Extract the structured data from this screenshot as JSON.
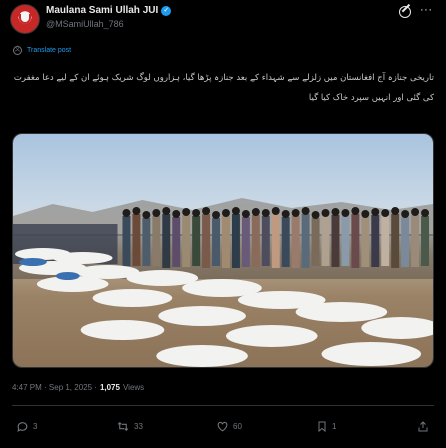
{
  "author": {
    "name": "Maulana Sami Ullah JUI",
    "handle": "@MSamiUllah_786"
  },
  "translate_label": "Translate post",
  "post_text": "تاریخی جنازہ آج افغانستان میں زلزلے سے شہداء کے بعد جنازہ پڑھا گیا، ہزاروں لوگ شریک ہوئے ان کے لیے دعا مغفرت کی گئی اور انہیں سپرد خاک کیا گیا",
  "timestamp": "4:47 PM · Sep 1, 2025 · ",
  "views_count": "1,075",
  "views_label": "Views",
  "actions": {
    "replies": "3",
    "reposts": "33",
    "likes": "60",
    "bookmarks": "1"
  },
  "icons": [
    "grok-icon",
    "more-icon",
    "translate-icon",
    "reply-icon",
    "repost-icon",
    "like-icon",
    "bookmark-icon",
    "share-icon"
  ],
  "colors": {
    "accent": "#1d9bf0",
    "background": "#000000",
    "muted": "#71767b"
  }
}
